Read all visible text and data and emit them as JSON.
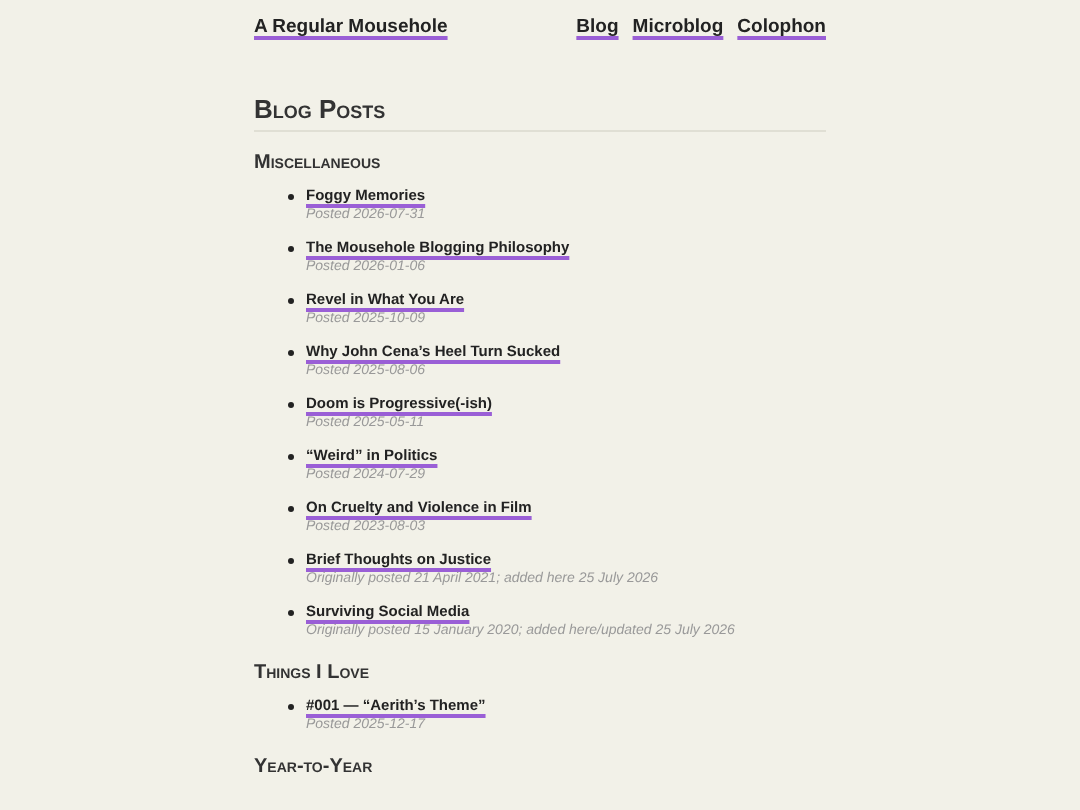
{
  "header": {
    "site_title": "A Regular Mousehole",
    "nav": [
      "Blog",
      "Microblog",
      "Colophon"
    ]
  },
  "page_title": "Blog Posts",
  "sections": [
    {
      "heading": "Miscellaneous",
      "posts": [
        {
          "title": "Foggy Memories",
          "meta": "Posted 2026-07-31"
        },
        {
          "title": "The Mousehole Blogging Philosophy",
          "meta": "Posted 2026-01-06"
        },
        {
          "title": "Revel in What You Are",
          "meta": "Posted 2025-10-09"
        },
        {
          "title": "Why John Cena’s Heel Turn Sucked",
          "meta": "Posted 2025-08-06"
        },
        {
          "title": "Doom is Progressive(-ish)",
          "meta": "Posted 2025-05-11"
        },
        {
          "title": "“Weird” in Politics",
          "meta": "Posted 2024-07-29"
        },
        {
          "title": "On Cruelty and Violence in Film",
          "meta": "Posted 2023-08-03"
        },
        {
          "title": "Brief Thoughts on Justice",
          "meta": "Originally posted 21 April 2021; added here 25 July 2026"
        },
        {
          "title": "Surviving Social Media",
          "meta": "Originally posted 15 January 2020; added here/updated 25 July 2026"
        }
      ]
    },
    {
      "heading": "Things I Love",
      "posts": [
        {
          "title": "#001 — “Aerith’s Theme”",
          "meta": "Posted 2025-12-17"
        }
      ]
    },
    {
      "heading": "Year-to-Year"
    }
  ]
}
